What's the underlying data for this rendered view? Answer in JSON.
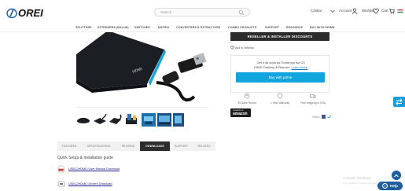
{
  "header": {
    "logo_text": "OREI",
    "search_placeholder": "Search",
    "currency": "Cdollar",
    "account": "Account",
    "wishlist": "Wishlist",
    "cart": "Cart"
  },
  "nav": {
    "items": [
      "SPLITTERS",
      "EXTENDERS (BALUN)",
      "SWITCHES",
      "MATRIX",
      "CONVERTERS & EXTRACTORS",
      "COMBO PRODUCTS",
      "SUPPORT",
      "RESOURCE",
      "BUY WITH PRIME"
    ]
  },
  "purchase": {
    "reseller_button": "RESELLER & INSTALLER DISCOUNTS",
    "wishlist_link": "Add to Wishlist",
    "shipping_line1": "Get it as soon as Tomorrow Apr 23",
    "shipping_line2": "FREE Delivery & Returns.",
    "shipping_link": "Learn more",
    "buy_button": "Buy with prime",
    "badges": [
      {
        "icon": "return-icon",
        "label": "30 Days Return"
      },
      {
        "icon": "shield-icon",
        "label": "1 Year Warranty"
      },
      {
        "icon": "truck-icon",
        "label": "Free shipping in USA"
      }
    ],
    "amazon_small": "Available at",
    "amazon_brand": "amazon",
    "share_label": "Share"
  },
  "tabs": [
    {
      "label": "FEATURES",
      "active": false
    },
    {
      "label": "SPECIFICATIONS",
      "active": false
    },
    {
      "label": "REVIEWS",
      "active": false
    },
    {
      "label": "DOWNLOADS",
      "active": true
    },
    {
      "label": "SUPPORT",
      "active": false
    },
    {
      "label": "RELATED",
      "active": false
    }
  ],
  "downloads": {
    "title": "Quick Setup & Installation guide",
    "items": [
      {
        "label": "USBC2HDMI2 User Manual Download",
        "icon": "pdf-icon"
      },
      {
        "label": "USBC2HDMI2 Drivers Download",
        "icon": "driver-icon"
      }
    ]
  },
  "widgets": {
    "help_label": "Help",
    "activate_title": "Activate Windows",
    "activate_sub": "Go to Settings to activate Windows."
  },
  "colors": {
    "accent": "#11a5dd",
    "dark": "#2c2c2c",
    "help": "#1f5f9e"
  }
}
